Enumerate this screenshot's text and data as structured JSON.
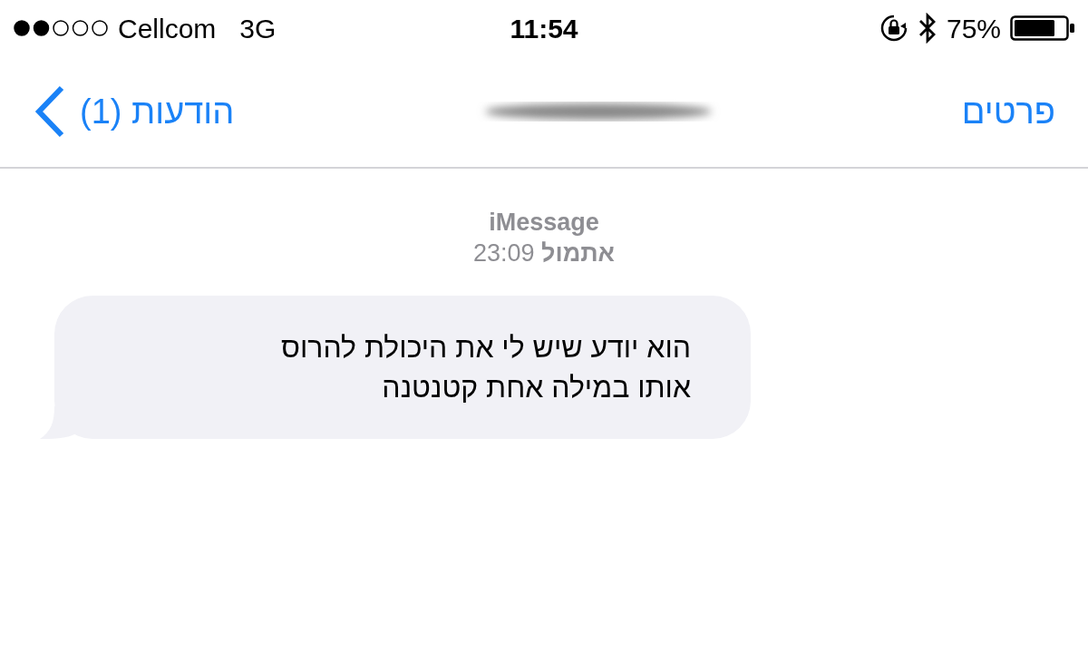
{
  "status_bar": {
    "carrier": "Cellcom",
    "network": "3G",
    "time": "11:54",
    "battery": "75%"
  },
  "nav": {
    "back": "הודעות (1)",
    "details": "פרטים"
  },
  "conversation": {
    "service": "iMessage",
    "timestamp": "**אתמול** 23:09",
    "messages": [
      {
        "kind": "incoming",
        "lines": [
          "הוא יודע שיש לי את היכולת להרוס",
          "אותו במילה אחת קטנטנה"
        ]
      }
    ]
  }
}
